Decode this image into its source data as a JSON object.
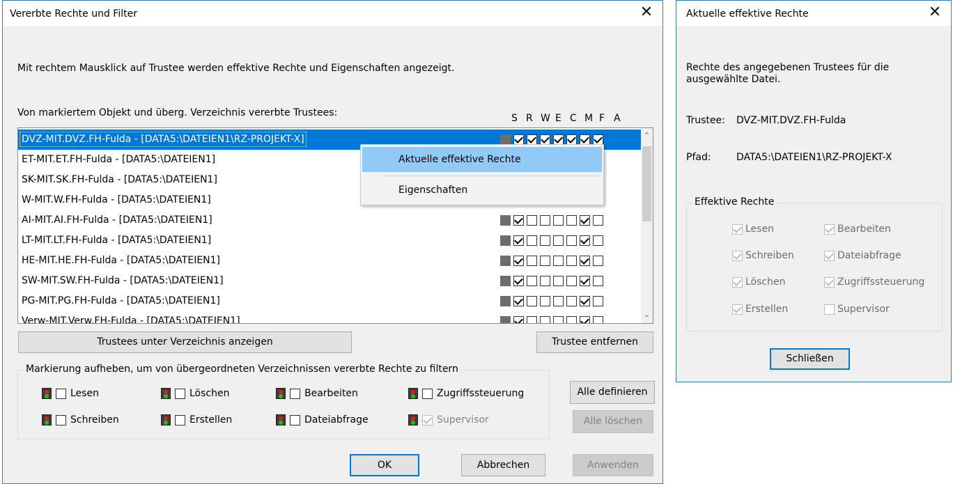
{
  "main_dialog": {
    "title": "Vererbte Rechte und Filter",
    "close": "✕",
    "info": "Mit rechtem Mausklick auf Trustee werden effektive Rechte und Eigenschaften angezeigt.",
    "list_label": "Von markiertem Objekt und überg. Verzeichnis vererbte Trustees:",
    "rights_header": [
      "S",
      "R",
      "W",
      "E",
      "C",
      "M",
      "F",
      "A"
    ],
    "trustees": [
      {
        "name": "DVZ-MIT.DVZ.FH-Fulda - [DATA5:\\DATEIEN1\\RZ-PROJEKT-X]",
        "rights": [
          false,
          true,
          true,
          true,
          true,
          true,
          true,
          true
        ],
        "selected": true
      },
      {
        "name": "ET-MIT.ET.FH-Fulda - [DATA5:\\DATEIEN1]",
        "rights": [
          false,
          true,
          false,
          false,
          false,
          false,
          true,
          false
        ]
      },
      {
        "name": "SK-MIT.SK.FH-Fulda - [DATA5:\\DATEIEN1]",
        "rights": [
          false,
          true,
          false,
          false,
          false,
          false,
          true,
          false
        ]
      },
      {
        "name": "W-MIT.W.FH-Fulda - [DATA5:\\DATEIEN1]",
        "rights": [
          false,
          true,
          false,
          false,
          false,
          false,
          true,
          false
        ]
      },
      {
        "name": "AI-MIT.AI.FH-Fulda - [DATA5:\\DATEIEN1]",
        "rights": [
          false,
          true,
          false,
          false,
          false,
          false,
          true,
          false
        ]
      },
      {
        "name": "LT-MIT.LT.FH-Fulda - [DATA5:\\DATEIEN1]",
        "rights": [
          false,
          true,
          false,
          false,
          false,
          false,
          true,
          false
        ]
      },
      {
        "name": "HE-MIT.HE.FH-Fulda - [DATA5:\\DATEIEN1]",
        "rights": [
          false,
          true,
          false,
          false,
          false,
          false,
          true,
          false
        ]
      },
      {
        "name": "SW-MIT.SW.FH-Fulda - [DATA5:\\DATEIEN1]",
        "rights": [
          false,
          true,
          false,
          false,
          false,
          false,
          true,
          false
        ]
      },
      {
        "name": "PG-MIT.PG.FH-Fulda - [DATA5:\\DATEIEN1]",
        "rights": [
          false,
          true,
          false,
          false,
          false,
          false,
          true,
          false
        ]
      },
      {
        "name": "Verw-MIT.Verw.FH-Fulda - [DATA5:\\DATEIEN1]",
        "rights": [
          false,
          true,
          false,
          false,
          false,
          false,
          true,
          false
        ]
      }
    ],
    "context_menu": {
      "items": [
        "Aktuelle effektive Rechte",
        "Eigenschaften"
      ]
    },
    "btn_show_trustees": "Trustees unter Verzeichnis anzeigen",
    "btn_remove_trustee": "Trustee entfernen",
    "filter_group_label": "Markierung aufheben, um von übergeordneten Verzeichnissen vererbte Rechte zu filtern",
    "filters": [
      {
        "label": "Lesen",
        "checked": false,
        "disabled": false
      },
      {
        "label": "Löschen",
        "checked": false,
        "disabled": false
      },
      {
        "label": "Bearbeiten",
        "checked": false,
        "disabled": false
      },
      {
        "label": "Zugriffssteuerung",
        "checked": false,
        "disabled": false
      },
      {
        "label": "Schreiben",
        "checked": false,
        "disabled": false
      },
      {
        "label": "Erstellen",
        "checked": false,
        "disabled": false
      },
      {
        "label": "Dateiabfrage",
        "checked": false,
        "disabled": false
      },
      {
        "label": "Supervisor",
        "checked": true,
        "disabled": true
      }
    ],
    "btn_define_all": "Alle definieren",
    "btn_clear_all": "Alle löschen",
    "btn_ok": "OK",
    "btn_cancel": "Abbrechen",
    "btn_apply": "Anwenden"
  },
  "eff_dialog": {
    "title": "Aktuelle effektive Rechte",
    "close": "✕",
    "desc": "Rechte des angegebenen Trustees für die ausgewählte Datei.",
    "trustee_label": "Trustee:",
    "trustee_value": "DVZ-MIT.DVZ.FH-Fulda",
    "path_label": "Pfad:",
    "path_value": "DATA5:\\DATEIEN1\\RZ-PROJEKT-X",
    "group_label": "Effektive Rechte",
    "rights": [
      {
        "label": "Lesen",
        "checked": true
      },
      {
        "label": "Bearbeiten",
        "checked": true
      },
      {
        "label": "Schreiben",
        "checked": true
      },
      {
        "label": "Dateiabfrage",
        "checked": true
      },
      {
        "label": "Löschen",
        "checked": true
      },
      {
        "label": "Zugriffssteuerung",
        "checked": true
      },
      {
        "label": "Erstellen",
        "checked": true
      },
      {
        "label": "Supervisor",
        "checked": false
      }
    ],
    "btn_close": "Schließen"
  }
}
